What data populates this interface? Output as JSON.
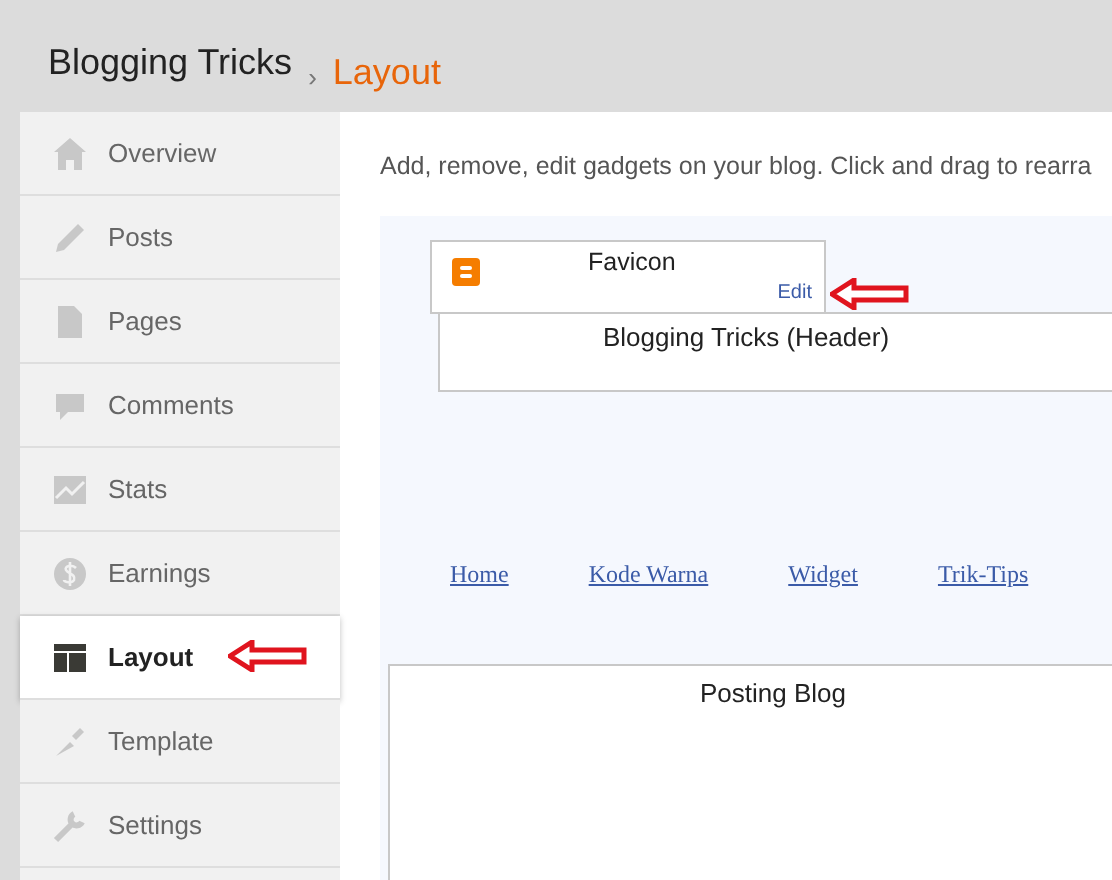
{
  "breadcrumb": {
    "blog": "Blogging Tricks",
    "separator": "›",
    "page": "Layout"
  },
  "sidebar": {
    "items": [
      {
        "label": "Overview",
        "selected": false
      },
      {
        "label": "Posts",
        "selected": false
      },
      {
        "label": "Pages",
        "selected": false
      },
      {
        "label": "Comments",
        "selected": false
      },
      {
        "label": "Stats",
        "selected": false
      },
      {
        "label": "Earnings",
        "selected": false
      },
      {
        "label": "Layout",
        "selected": true
      },
      {
        "label": "Template",
        "selected": false
      },
      {
        "label": "Settings",
        "selected": false
      }
    ]
  },
  "intro": "Add, remove, edit gadgets on your blog. Click and drag to rearra",
  "layout": {
    "dragged_gadget": {
      "title": "Favicon",
      "edit": "Edit"
    },
    "header_gadget": "Blogging Tricks (Header)",
    "nav_links": [
      "Home",
      "Kode Warna",
      "Widget",
      "Trik-Tips"
    ],
    "main_gadget": "Posting Blog"
  }
}
